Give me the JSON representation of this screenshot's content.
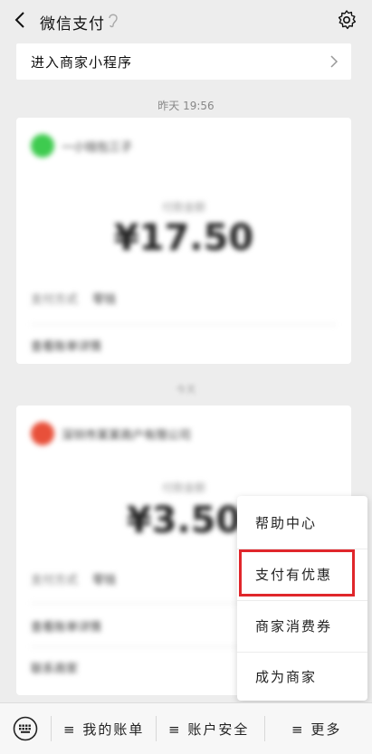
{
  "header": {
    "title": "微信支付"
  },
  "mini_program_card": {
    "label": "进入商家小程序"
  },
  "timestamp": "昨天 19:56",
  "transactions": [
    {
      "merchant_name": "一小钱包三子",
      "avatar_color": "#3ecb4f",
      "amount_caption": "付款金额",
      "amount": "¥17.50",
      "payment_method_label": "支付方式",
      "payment_method_value": "零钱",
      "bill_link": "查看账单详情"
    },
    {
      "merchant_name": "深圳市某某商户有限公司",
      "avatar_color": "#e8503a",
      "amount_caption": "付款金额",
      "amount": "¥3.50",
      "payment_method_label": "支付方式",
      "payment_method_value": "零钱",
      "bill_link": "查看账单详情",
      "bill_link_2": "联系商家"
    }
  ],
  "separator_text": "今天",
  "menu": {
    "items": [
      {
        "label": "帮助中心"
      },
      {
        "label": "支付有优惠"
      },
      {
        "label": "商家消费券"
      },
      {
        "label": "成为商家"
      }
    ],
    "highlight_color": "#e0262b"
  },
  "bottom_bar": {
    "tabs": [
      {
        "label": "≡ 我的账单"
      },
      {
        "label": "≡ 账户安全"
      },
      {
        "label": "≡ 更多"
      }
    ]
  }
}
